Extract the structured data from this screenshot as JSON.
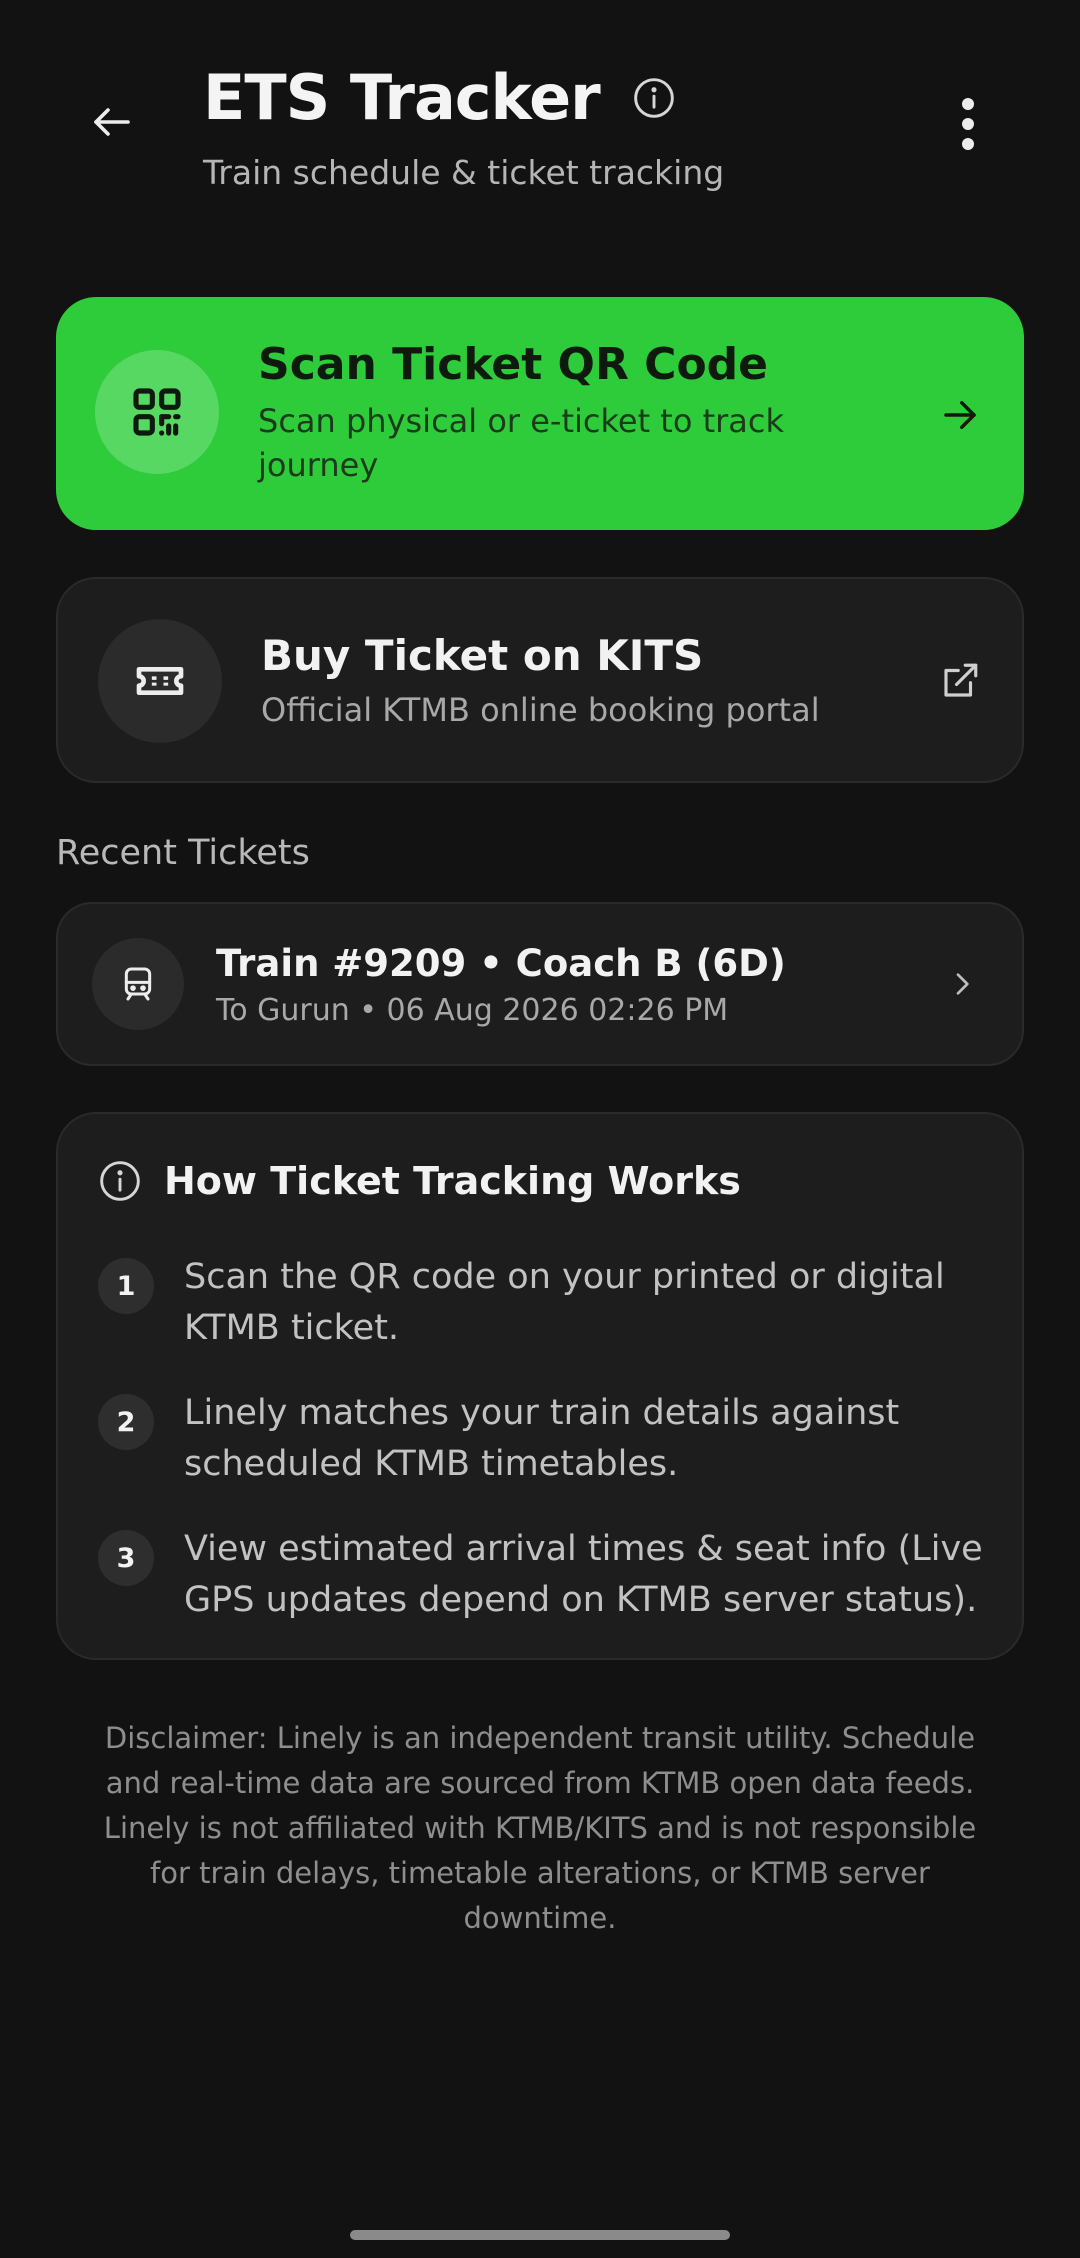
{
  "header": {
    "title": "ETS Tracker",
    "subtitle": "Train schedule & ticket tracking",
    "back_icon": "arrow-left-icon",
    "info_icon": "info-icon",
    "more_icon": "more-vertical-icon"
  },
  "scan_card": {
    "title": "Scan Ticket QR Code",
    "subtitle": "Scan physical or e-ticket to track journey",
    "icon": "qr-code-icon",
    "arrow_icon": "arrow-right-icon",
    "accent_color": "#2ecc3a"
  },
  "buy_card": {
    "title": "Buy Ticket on KITS",
    "subtitle": "Official KTMB online booking portal",
    "icon": "ticket-icon",
    "external_icon": "external-link-icon"
  },
  "recent": {
    "heading": "Recent Tickets",
    "tickets": [
      {
        "title": "Train #9209 • Coach B (6D)",
        "subtitle": "To Gurun • 06 Aug 2026 02:26 PM",
        "icon": "train-icon"
      }
    ]
  },
  "how_it_works": {
    "title": "How Ticket Tracking Works",
    "steps": [
      {
        "number": "1",
        "text": "Scan the QR code on your printed or digital KTMB ticket."
      },
      {
        "number": "2",
        "text": "Linely matches your train details against scheduled KTMB timetables."
      },
      {
        "number": "3",
        "text": "View estimated arrival times & seat info (Live GPS updates depend on KTMB server status)."
      }
    ]
  },
  "disclaimer": "Disclaimer: Linely is an independent transit utility. Schedule and real-time data are sourced from KTMB open data feeds. Linely is not affiliated with KTMB/KITS and is not responsible for train delays, timetable alterations, or KTMB server downtime."
}
